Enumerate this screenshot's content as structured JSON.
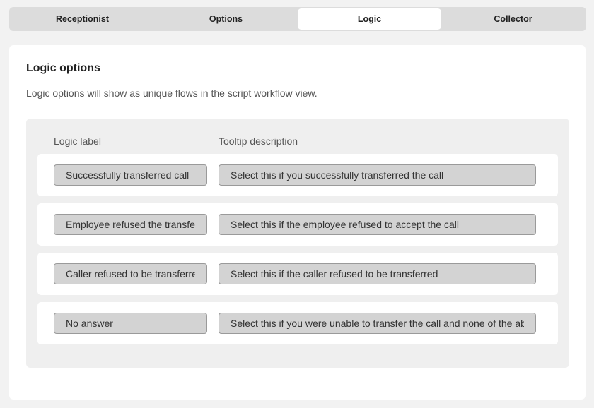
{
  "tabs": [
    {
      "label": "Receptionist",
      "active": false
    },
    {
      "label": "Options",
      "active": false
    },
    {
      "label": "Logic",
      "active": true
    },
    {
      "label": "Collector",
      "active": false
    }
  ],
  "section": {
    "title": "Logic options",
    "description": "Logic options will show as unique flows in the script workflow view."
  },
  "columns": {
    "label": "Logic label",
    "tooltip": "Tooltip description"
  },
  "rows": [
    {
      "label": "Successfully transferred call",
      "tooltip": "Select this if you successfully transferred the call"
    },
    {
      "label": "Employee refused the transfer",
      "tooltip": "Select this if the employee refused to accept the call"
    },
    {
      "label": "Caller refused to be transferred",
      "tooltip": "Select this if the caller refused to be transferred"
    },
    {
      "label": "No answer",
      "tooltip": "Select this if you were unable to transfer the call and none of the above"
    }
  ]
}
